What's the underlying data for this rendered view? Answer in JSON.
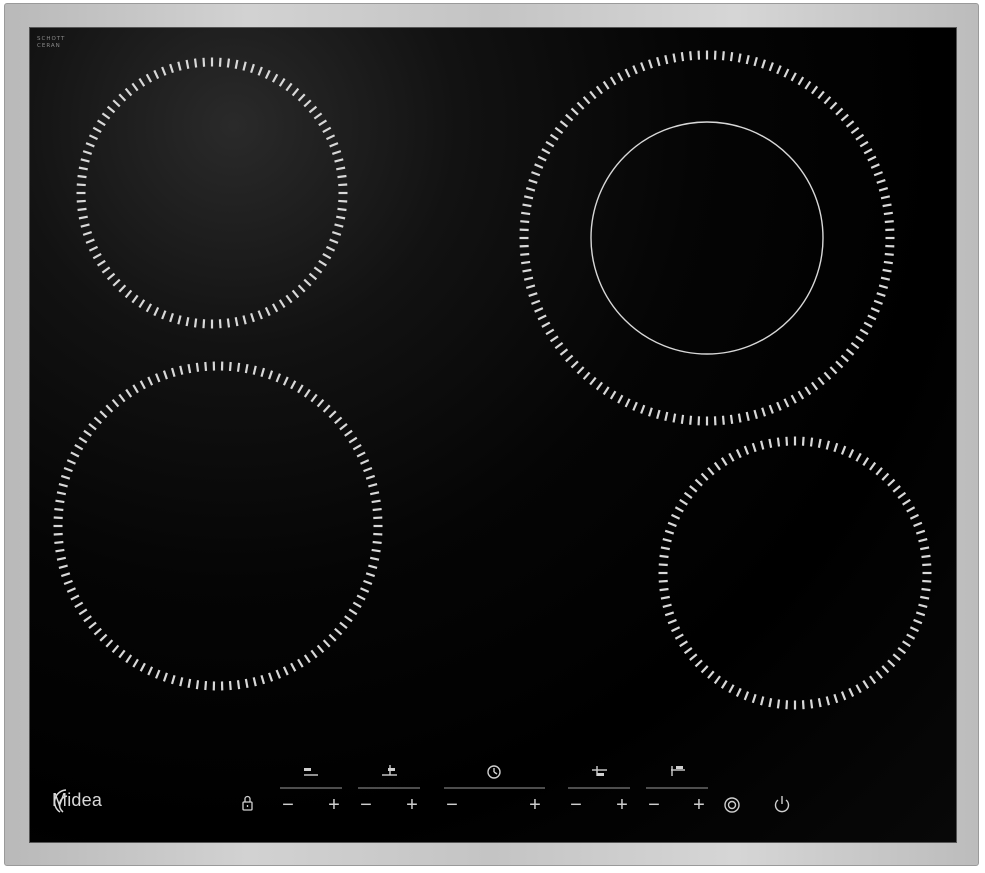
{
  "brand": {
    "name": "Midea",
    "glass_mark_line1": "SCHOTT",
    "glass_mark_line2": "CERAN"
  },
  "zones": [
    {
      "name": "rear-left-zone",
      "type": "single"
    },
    {
      "name": "rear-right-zone",
      "type": "dual"
    },
    {
      "name": "front-left-zone",
      "type": "single"
    },
    {
      "name": "front-right-zone",
      "type": "single"
    }
  ],
  "controls": {
    "minus": "−",
    "plus": "+",
    "labels": [
      "Rear left",
      "Rear right",
      "Timer",
      "Front left",
      "Front right"
    ]
  },
  "colors": {
    "glass": "#000000",
    "frame": "#c8c8c8",
    "markings": "#d8d8d8"
  }
}
